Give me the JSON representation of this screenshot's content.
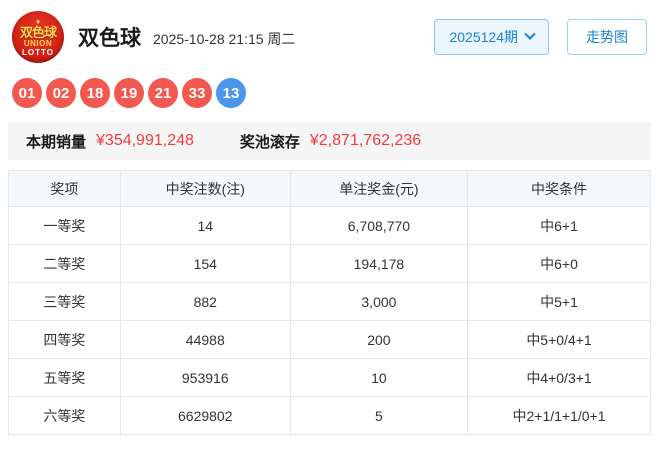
{
  "header": {
    "logo": {
      "zh": "双色球",
      "en1": "UNION",
      "en2": "LOTTO"
    },
    "title": "双色球",
    "datetime": "2025-10-28 21:15 周二",
    "issue_selector_label": "2025124期",
    "trend_button_label": "走势图"
  },
  "balls": {
    "red_numbers": [
      "01",
      "02",
      "18",
      "19",
      "21",
      "33"
    ],
    "blue_numbers": [
      "13"
    ],
    "red_color": "#f25850",
    "blue_color": "#4a96e8"
  },
  "sales": {
    "sales_label": "本期销量",
    "sales_value": "¥354,991,248",
    "pool_label": "奖池滚存",
    "pool_value": "¥2,871,762,236",
    "value_color": "#f13b3d"
  },
  "prize_table": {
    "headers": [
      "奖项",
      "中奖注数(注)",
      "单注奖金(元)",
      "中奖条件"
    ],
    "rows": [
      {
        "tier": "一等奖",
        "winners": "14",
        "prize": "6,708,770",
        "condition": "中6+1"
      },
      {
        "tier": "二等奖",
        "winners": "154",
        "prize": "194,178",
        "condition": "中6+0"
      },
      {
        "tier": "三等奖",
        "winners": "882",
        "prize": "3,000",
        "condition": "中5+1"
      },
      {
        "tier": "四等奖",
        "winners": "44988",
        "prize": "200",
        "condition": "中5+0/4+1"
      },
      {
        "tier": "五等奖",
        "winners": "953916",
        "prize": "10",
        "condition": "中4+0/3+1"
      },
      {
        "tier": "六等奖",
        "winners": "6629802",
        "prize": "5",
        "condition": "中2+1/1+1/0+1"
      }
    ]
  }
}
